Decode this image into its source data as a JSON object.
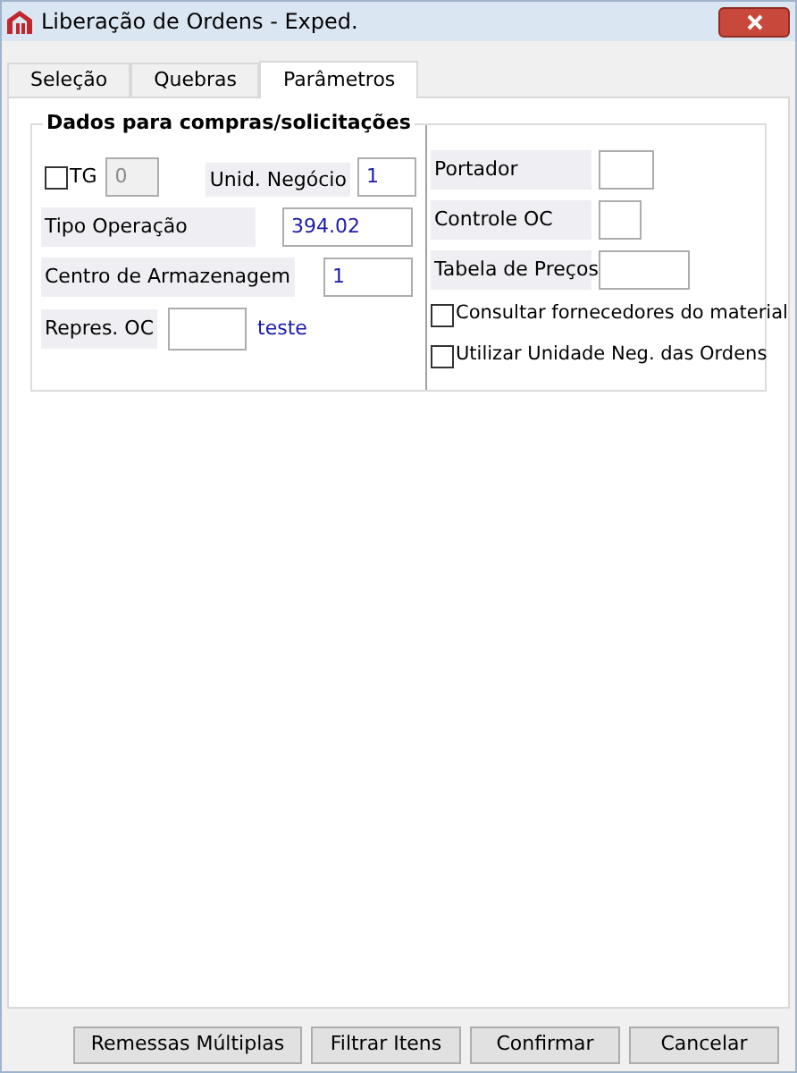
{
  "window": {
    "title": "Liberação de Ordens - Exped."
  },
  "tabs": [
    {
      "label": "Seleção",
      "selected": false
    },
    {
      "label": "Quebras",
      "selected": false
    },
    {
      "label": "Parâmetros",
      "selected": true
    }
  ],
  "group": {
    "title": "Dados para compras/solicitações"
  },
  "tg": {
    "label": "TG",
    "checked": false,
    "value": "0",
    "disabled": true
  },
  "unid_negocio": {
    "label": "Unid. Negócio",
    "value": "1"
  },
  "tipo_operacao": {
    "label": "Tipo Operação",
    "value": "394.02"
  },
  "centro_armazenagem": {
    "label": "Centro de Armazenagem",
    "value": "1"
  },
  "repres_oc": {
    "label": "Repres. OC",
    "description": "teste"
  },
  "portador": {
    "label": "Portador"
  },
  "controle_oc": {
    "label": "Controle OC"
  },
  "tabela_precos": {
    "label": "Tabela de Preços"
  },
  "options": [
    {
      "label": "Consultar fornecedores do material",
      "checked": false
    },
    {
      "label": "Utilizar Unidade Neg. das Ordens",
      "checked": false
    }
  ],
  "buttons": [
    "Remessas Múltiplas",
    "Filtrar Itens",
    "Confirmar",
    "Cancelar"
  ]
}
